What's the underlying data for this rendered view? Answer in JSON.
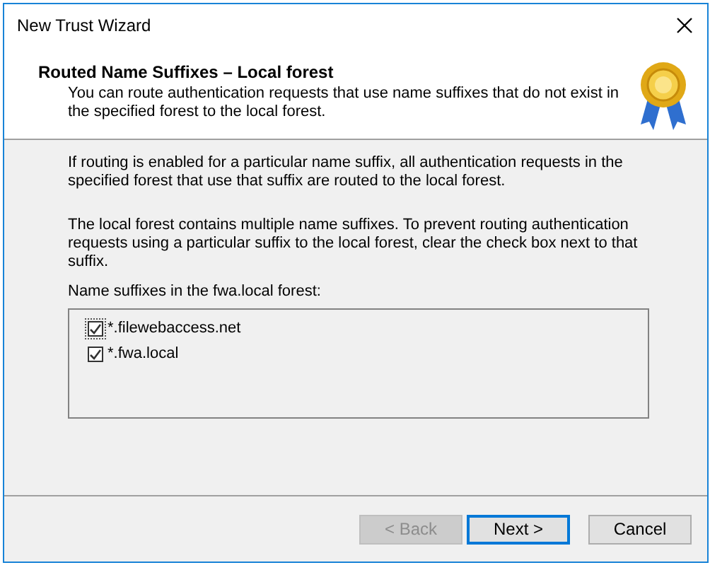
{
  "window": {
    "title": "New Trust Wizard"
  },
  "header": {
    "title": "Routed Name Suffixes – Local forest",
    "description": "You can route authentication requests that use name suffixes that do not exist in the specified forest to the local forest."
  },
  "paragraphs": [
    "If routing is enabled for a particular name suffix, all authentication requests in the specified forest that use that suffix are routed to the local forest.",
    "The local forest contains multiple name suffixes. To prevent routing authentication requests using a particular suffix to the local forest, clear the check box next to that suffix."
  ],
  "list": {
    "label": "Name suffixes in the fwa.local forest:",
    "items": [
      {
        "label": "*.filewebaccess.net",
        "checked": true,
        "selected": true
      },
      {
        "label": "*.fwa.local",
        "checked": true,
        "selected": false
      }
    ]
  },
  "buttons": [
    {
      "label": "< Back",
      "disabled": true,
      "default": false
    },
    {
      "label": "Next >",
      "disabled": false,
      "default": true
    },
    {
      "label": "Cancel",
      "disabled": false,
      "default": false
    }
  ]
}
